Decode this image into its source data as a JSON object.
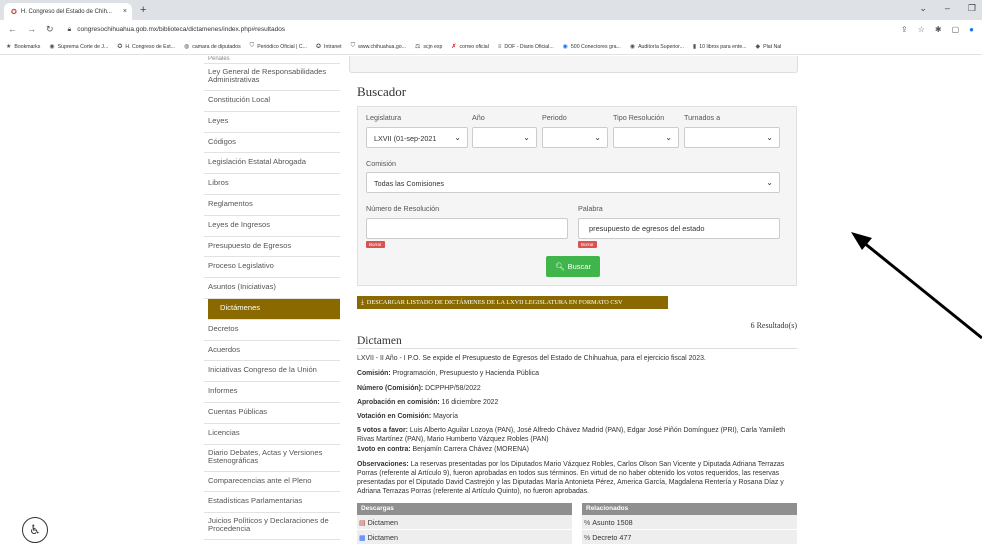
{
  "browser": {
    "tab_title": "H. Congreso del Estado de Chih...",
    "tab_close": "×",
    "new_tab": "+",
    "url": "congresochihuahua.gob.mx/biblioteca/dictamenes/index.php#resultados",
    "bookmarks": [
      "Bookmarks",
      "Suprema Corte de J...",
      "H. Congreso de Est...",
      "camara de diputados",
      "Periódico Oficial | C...",
      "Intranet",
      "www.chihuahua.go...",
      "scjn exp",
      "correo oficial",
      "DOF - Diario Oficial...",
      "500 Conectores gra...",
      "Auditoría Superior...",
      "10 libros para ente...",
      "Plat Nal"
    ]
  },
  "sidebar": {
    "top_cut": "Penales",
    "items": [
      "Ley General de Responsabilidades Administrativas",
      "Constitución Local",
      "Leyes",
      "Códigos",
      "Legislación Estatal Abrogada",
      "Libros",
      "Reglamentos",
      "Leyes de Ingresos",
      "Presupuesto de Egresos",
      "Proceso Legislativo",
      "Asuntos (Iniciativas)",
      "Dictámenes",
      "Decretos",
      "Acuerdos",
      "Iniciativas Congreso de la Unión",
      "Informes",
      "Cuentas Públicas",
      "Licencias",
      "Diario Debates, Actas y Versiones Estenográficas",
      "Comparecencias ante el Pleno",
      "Estadísticas Parlamentarias",
      "Juicios Políticos y Declaraciones de Procedencia"
    ]
  },
  "buscador": {
    "title": "Buscador",
    "legislatura_label": "Legislatura",
    "legislatura_value": "LXVII (01-sep-2021",
    "anio_label": "Año",
    "periodo_label": "Periodo",
    "tipo_label": "Tipo Resolución",
    "turnados_label": "Turnados a",
    "comision_label": "Comisión",
    "comision_value": "Todas las Comisiones",
    "numero_label": "Número de Resolución",
    "numero_value": "",
    "palabra_label": "Palabra",
    "palabra_value": "presupuesto de egresos del estado",
    "borrar": "Borrar",
    "buscar": "Buscar",
    "csv": "DESCARGAR LISTADO DE DICTÁMENES DE LA LXVII LEGISLATURA EN FORMATO CSV"
  },
  "resultados": "6 Resultado(s)",
  "dictamen": {
    "title": "Dictamen",
    "desc": "LXVII - II Año - I P.O. Se expide el Presupuesto de Egresos del Estado de Chihuahua, para el ejercicio fiscal 2023.",
    "comision_k": "Comisión:",
    "comision_v": "Programación, Presupuesto y Hacienda Pública",
    "numero_k": "Número (Comisión):",
    "numero_v": "DCPPHP/58/2022",
    "aprob_k": "Aprobación en comisión:",
    "aprob_v": "16 diciembre 2022",
    "votacion_k": "Votación en Comisión:",
    "votacion_v": "Mayoría",
    "favor_k": "5 votos a favor:",
    "favor_v": "Luis Alberto Aguilar Lozoya (PAN), José Alfredo Chávez Madrid (PAN), Edgar José Piñón Domínguez (PRI), Carla Yamileth Rivas Martínez (PAN), Mario Humberto Vázquez Robles (PAN)",
    "contra_k": "1voto en contra:",
    "contra_v": "Benjamín Carrera Chávez (MORENA)",
    "obs_k": "Observaciones:",
    "obs_v": "La reservas presentadas por los Diputados Mario Vázquez Robles, Carlos Olson San Vicente y Diputada Adriana Terrazas Porras (referente al Artículo 9), fueron aprobadas en todos sus términos. En virtud de no haber obtenido los votos requeridos, las reservas presentadas por el Diputado David Castrejón y las Diputadas María Antonieta Pérez, America García, Magdalena Rentería y Rosana Díaz y Adriana Terrazas Porras (referente al Artículo Quinto), no fueron aprobadas."
  },
  "tabla": {
    "descargas": "Descargas",
    "relacionados": "Relacionados",
    "rows": [
      {
        "left": "Dictamen",
        "right": "Asunto 1508"
      },
      {
        "left": "Dictamen",
        "right": "Decreto 477"
      }
    ]
  }
}
